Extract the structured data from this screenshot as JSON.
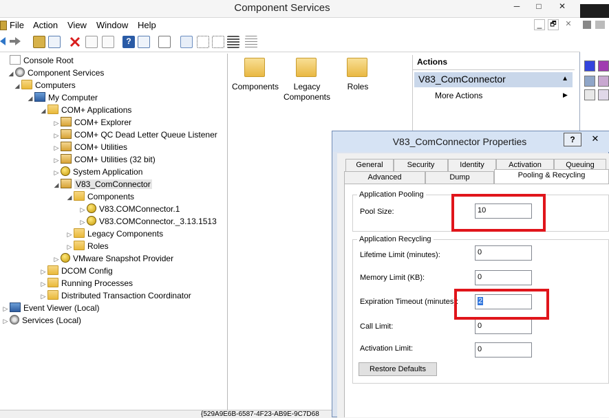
{
  "window": {
    "title": "Component Services",
    "caption_min": "─",
    "caption_restore": "□",
    "caption_close": "✕",
    "mdi_min": "_",
    "mdi_restore": "🗗",
    "mdi_close": "✕"
  },
  "menu": [
    "File",
    "Action",
    "View",
    "Window",
    "Help"
  ],
  "tree": [
    {
      "label": "Console Root",
      "exp": "",
      "icon": "root",
      "indent": 0
    },
    {
      "label": "Component Services",
      "exp": "◢",
      "icon": "gear",
      "indent": 1
    },
    {
      "label": "Computers",
      "exp": "◢",
      "icon": "folder",
      "indent": 2
    },
    {
      "label": "My Computer",
      "exp": "◢",
      "icon": "computer",
      "indent": 3
    },
    {
      "label": "COM+ Applications",
      "exp": "◢",
      "icon": "folder",
      "indent": 4
    },
    {
      "label": "COM+ Explorer",
      "exp": "▷",
      "icon": "pkg",
      "indent": 5
    },
    {
      "label": "COM+ QC Dead Letter Queue Listener",
      "exp": "▷",
      "icon": "pkg",
      "indent": 5
    },
    {
      "label": "COM+ Utilities",
      "exp": "▷",
      "icon": "pkg",
      "indent": 5
    },
    {
      "label": "COM+ Utilities (32 bit)",
      "exp": "▷",
      "icon": "pkg",
      "indent": 5
    },
    {
      "label": "System Application",
      "exp": "▷",
      "icon": "ball",
      "indent": 5
    },
    {
      "label": "V83_ComConnector",
      "exp": "◢",
      "icon": "pkg",
      "indent": 5
    },
    {
      "label": "Components",
      "exp": "◢",
      "icon": "folder",
      "indent": 6
    },
    {
      "label": "V83.COMConnector.1",
      "exp": "▷",
      "icon": "ball",
      "indent": 7
    },
    {
      "label": "V83.COMConnector._3.13.1513",
      "exp": "▷",
      "icon": "ball",
      "indent": 7
    },
    {
      "label": "Legacy Components",
      "exp": "▷",
      "icon": "folder",
      "indent": 6
    },
    {
      "label": "Roles",
      "exp": "▷",
      "icon": "folder",
      "indent": 6
    },
    {
      "label": "VMware Snapshot Provider",
      "exp": "▷",
      "icon": "ball",
      "indent": 5
    },
    {
      "label": "DCOM Config",
      "exp": "▷",
      "icon": "folder",
      "indent": 4
    },
    {
      "label": "Running Processes",
      "exp": "▷",
      "icon": "folder",
      "indent": 4
    },
    {
      "label": "Distributed Transaction Coordinator",
      "exp": "▷",
      "icon": "folder",
      "indent": 4
    },
    {
      "label": "Event Viewer (Local)",
      "exp": "▷",
      "icon": "computer",
      "indent": 0
    },
    {
      "label": "Services (Local)",
      "exp": "▷",
      "icon": "gear",
      "indent": 0
    }
  ],
  "list": [
    {
      "label": "Components"
    },
    {
      "label": "Legacy Components"
    },
    {
      "label": "Roles"
    }
  ],
  "actions": {
    "header": "Actions",
    "section": "V83_ComConnector",
    "more": "More Actions",
    "collapse_glyph": "▲",
    "more_glyph": "▶"
  },
  "dialog": {
    "title": "V83_ComConnector Properties",
    "help_btn": "?",
    "close_btn": "✕",
    "tabs_row1": [
      "General",
      "Security",
      "Identity",
      "Activation",
      "Queuing"
    ],
    "tabs_row2": [
      "Advanced",
      "Dump",
      "Pooling & Recycling"
    ],
    "pooling_group": "Application Pooling",
    "pool_size_label": "Pool Size:",
    "pool_size_value": "10",
    "recycling_group": "Application Recycling",
    "fields": [
      {
        "label": "Lifetime Limit (minutes):",
        "value": "0"
      },
      {
        "label": "Memory Limit (KB):",
        "value": "0"
      },
      {
        "label": "Expiration Timeout (minutes):",
        "value": "2"
      },
      {
        "label": "Call Limit:",
        "value": "0"
      },
      {
        "label": "Activation Limit:",
        "value": "0"
      }
    ],
    "restore_defaults": "Restore Defaults"
  },
  "statusbar": {
    "text": "{529A9E6B-6587-4F23-AB9E-9C7D68"
  },
  "colors": {
    "highlight": "#e0151b",
    "actions_bg": "#c9d7ea",
    "dialog_title": "#d6e3f4"
  }
}
